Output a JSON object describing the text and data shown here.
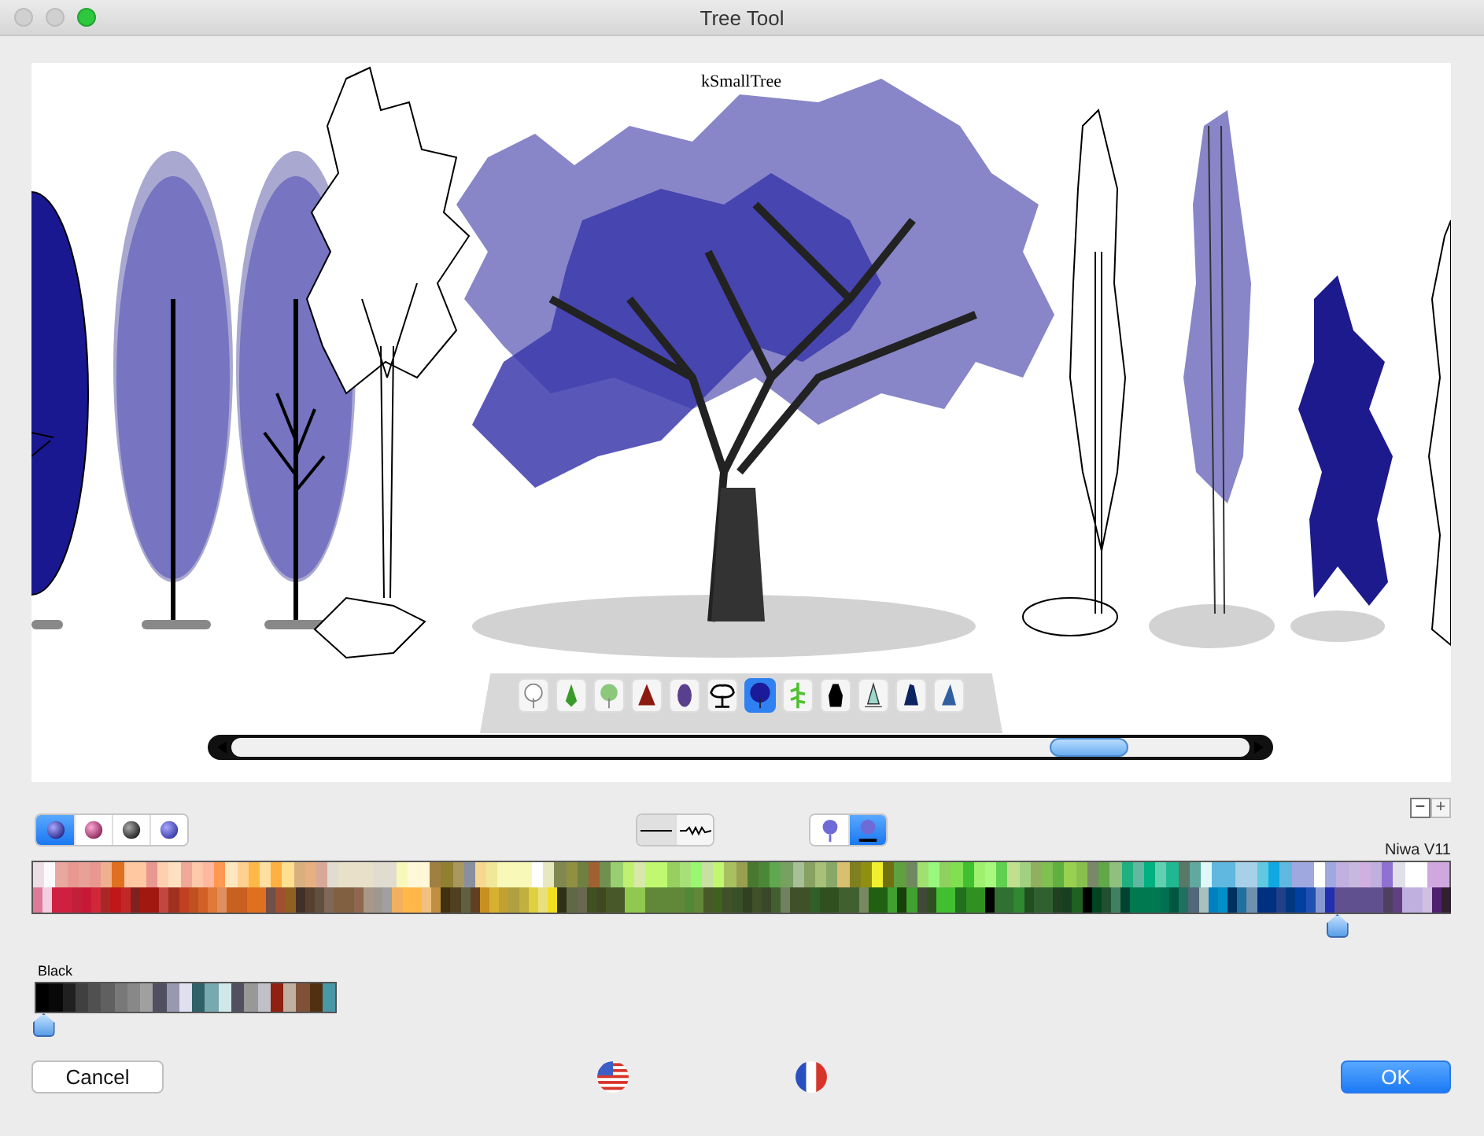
{
  "window": {
    "title": "Tree Tool"
  },
  "preview": {
    "tree_name": "kSmallTree"
  },
  "tree_styles": [
    {
      "selected": false
    },
    {
      "selected": false
    },
    {
      "selected": false
    },
    {
      "selected": false
    },
    {
      "selected": false
    },
    {
      "selected": false
    },
    {
      "selected": true
    },
    {
      "selected": false
    },
    {
      "selected": false
    },
    {
      "selected": false
    },
    {
      "selected": false
    },
    {
      "selected": false
    }
  ],
  "shading_modes": [
    {
      "selected": true
    },
    {
      "selected": false
    },
    {
      "selected": false
    },
    {
      "selected": false
    }
  ],
  "line_modes": [
    {
      "selected": true
    },
    {
      "selected": false
    }
  ],
  "pin_modes": [
    {
      "selected": false
    },
    {
      "selected": true
    }
  ],
  "zoom_buttons": [
    "−",
    "+"
  ],
  "main_palette": {
    "name": "Niwa V11",
    "level": 0.92
  },
  "small_palette": {
    "name": "Black",
    "level": 0.03
  },
  "buttons": {
    "cancel": "Cancel",
    "ok": "OK"
  }
}
